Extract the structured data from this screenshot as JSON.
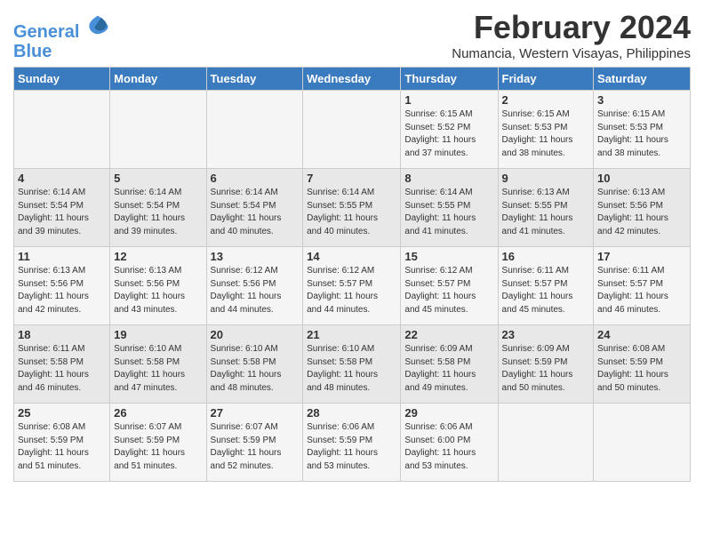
{
  "logo": {
    "line1": "General",
    "line2": "Blue"
  },
  "title": "February 2024",
  "location": "Numancia, Western Visayas, Philippines",
  "days_of_week": [
    "Sunday",
    "Monday",
    "Tuesday",
    "Wednesday",
    "Thursday",
    "Friday",
    "Saturday"
  ],
  "weeks": [
    [
      {
        "day": "",
        "info": ""
      },
      {
        "day": "",
        "info": ""
      },
      {
        "day": "",
        "info": ""
      },
      {
        "day": "",
        "info": ""
      },
      {
        "day": "1",
        "info": "Sunrise: 6:15 AM\nSunset: 5:52 PM\nDaylight: 11 hours\nand 37 minutes."
      },
      {
        "day": "2",
        "info": "Sunrise: 6:15 AM\nSunset: 5:53 PM\nDaylight: 11 hours\nand 38 minutes."
      },
      {
        "day": "3",
        "info": "Sunrise: 6:15 AM\nSunset: 5:53 PM\nDaylight: 11 hours\nand 38 minutes."
      }
    ],
    [
      {
        "day": "4",
        "info": "Sunrise: 6:14 AM\nSunset: 5:54 PM\nDaylight: 11 hours\nand 39 minutes."
      },
      {
        "day": "5",
        "info": "Sunrise: 6:14 AM\nSunset: 5:54 PM\nDaylight: 11 hours\nand 39 minutes."
      },
      {
        "day": "6",
        "info": "Sunrise: 6:14 AM\nSunset: 5:54 PM\nDaylight: 11 hours\nand 40 minutes."
      },
      {
        "day": "7",
        "info": "Sunrise: 6:14 AM\nSunset: 5:55 PM\nDaylight: 11 hours\nand 40 minutes."
      },
      {
        "day": "8",
        "info": "Sunrise: 6:14 AM\nSunset: 5:55 PM\nDaylight: 11 hours\nand 41 minutes."
      },
      {
        "day": "9",
        "info": "Sunrise: 6:13 AM\nSunset: 5:55 PM\nDaylight: 11 hours\nand 41 minutes."
      },
      {
        "day": "10",
        "info": "Sunrise: 6:13 AM\nSunset: 5:56 PM\nDaylight: 11 hours\nand 42 minutes."
      }
    ],
    [
      {
        "day": "11",
        "info": "Sunrise: 6:13 AM\nSunset: 5:56 PM\nDaylight: 11 hours\nand 42 minutes."
      },
      {
        "day": "12",
        "info": "Sunrise: 6:13 AM\nSunset: 5:56 PM\nDaylight: 11 hours\nand 43 minutes."
      },
      {
        "day": "13",
        "info": "Sunrise: 6:12 AM\nSunset: 5:56 PM\nDaylight: 11 hours\nand 44 minutes."
      },
      {
        "day": "14",
        "info": "Sunrise: 6:12 AM\nSunset: 5:57 PM\nDaylight: 11 hours\nand 44 minutes."
      },
      {
        "day": "15",
        "info": "Sunrise: 6:12 AM\nSunset: 5:57 PM\nDaylight: 11 hours\nand 45 minutes."
      },
      {
        "day": "16",
        "info": "Sunrise: 6:11 AM\nSunset: 5:57 PM\nDaylight: 11 hours\nand 45 minutes."
      },
      {
        "day": "17",
        "info": "Sunrise: 6:11 AM\nSunset: 5:57 PM\nDaylight: 11 hours\nand 46 minutes."
      }
    ],
    [
      {
        "day": "18",
        "info": "Sunrise: 6:11 AM\nSunset: 5:58 PM\nDaylight: 11 hours\nand 46 minutes."
      },
      {
        "day": "19",
        "info": "Sunrise: 6:10 AM\nSunset: 5:58 PM\nDaylight: 11 hours\nand 47 minutes."
      },
      {
        "day": "20",
        "info": "Sunrise: 6:10 AM\nSunset: 5:58 PM\nDaylight: 11 hours\nand 48 minutes."
      },
      {
        "day": "21",
        "info": "Sunrise: 6:10 AM\nSunset: 5:58 PM\nDaylight: 11 hours\nand 48 minutes."
      },
      {
        "day": "22",
        "info": "Sunrise: 6:09 AM\nSunset: 5:58 PM\nDaylight: 11 hours\nand 49 minutes."
      },
      {
        "day": "23",
        "info": "Sunrise: 6:09 AM\nSunset: 5:59 PM\nDaylight: 11 hours\nand 50 minutes."
      },
      {
        "day": "24",
        "info": "Sunrise: 6:08 AM\nSunset: 5:59 PM\nDaylight: 11 hours\nand 50 minutes."
      }
    ],
    [
      {
        "day": "25",
        "info": "Sunrise: 6:08 AM\nSunset: 5:59 PM\nDaylight: 11 hours\nand 51 minutes."
      },
      {
        "day": "26",
        "info": "Sunrise: 6:07 AM\nSunset: 5:59 PM\nDaylight: 11 hours\nand 51 minutes."
      },
      {
        "day": "27",
        "info": "Sunrise: 6:07 AM\nSunset: 5:59 PM\nDaylight: 11 hours\nand 52 minutes."
      },
      {
        "day": "28",
        "info": "Sunrise: 6:06 AM\nSunset: 5:59 PM\nDaylight: 11 hours\nand 53 minutes."
      },
      {
        "day": "29",
        "info": "Sunrise: 6:06 AM\nSunset: 6:00 PM\nDaylight: 11 hours\nand 53 minutes."
      },
      {
        "day": "",
        "info": ""
      },
      {
        "day": "",
        "info": ""
      }
    ]
  ]
}
